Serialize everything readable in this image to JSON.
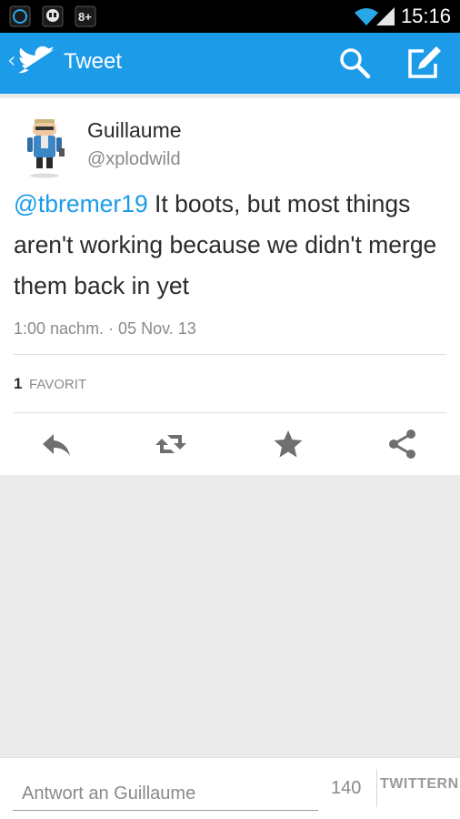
{
  "status_bar": {
    "time": "15:16",
    "icons": [
      "sync-icon",
      "hangouts-icon",
      "google-plus-icon",
      "wifi-icon",
      "signal-icon"
    ]
  },
  "action_bar": {
    "title": "Tweet",
    "back_icon": "chevron-left-icon",
    "logo_icon": "twitter-bird-icon",
    "search_icon": "search-icon",
    "compose_icon": "compose-icon",
    "color": "#1b9be8"
  },
  "tweet": {
    "author_name": "Guillaume",
    "author_handle": "@xplodwild",
    "mention": "@tbremer19",
    "text": " It boots, but most things aren't working because we didn't merge them back in yet",
    "timestamp": "1:00 nachm. · 05 Nov. 13",
    "favorites_count": "1",
    "favorites_label": "FAVORIT",
    "actions": [
      "reply-icon",
      "retweet-icon",
      "favorite-icon",
      "share-icon"
    ]
  },
  "reply_bar": {
    "placeholder": "Antwort an Guillaume",
    "char_count": "140",
    "submit_label": "TWITTERN"
  },
  "colors": {
    "accent": "#1b9be8",
    "background": "#ebebeb",
    "icon_grey": "#6f6f6f"
  }
}
